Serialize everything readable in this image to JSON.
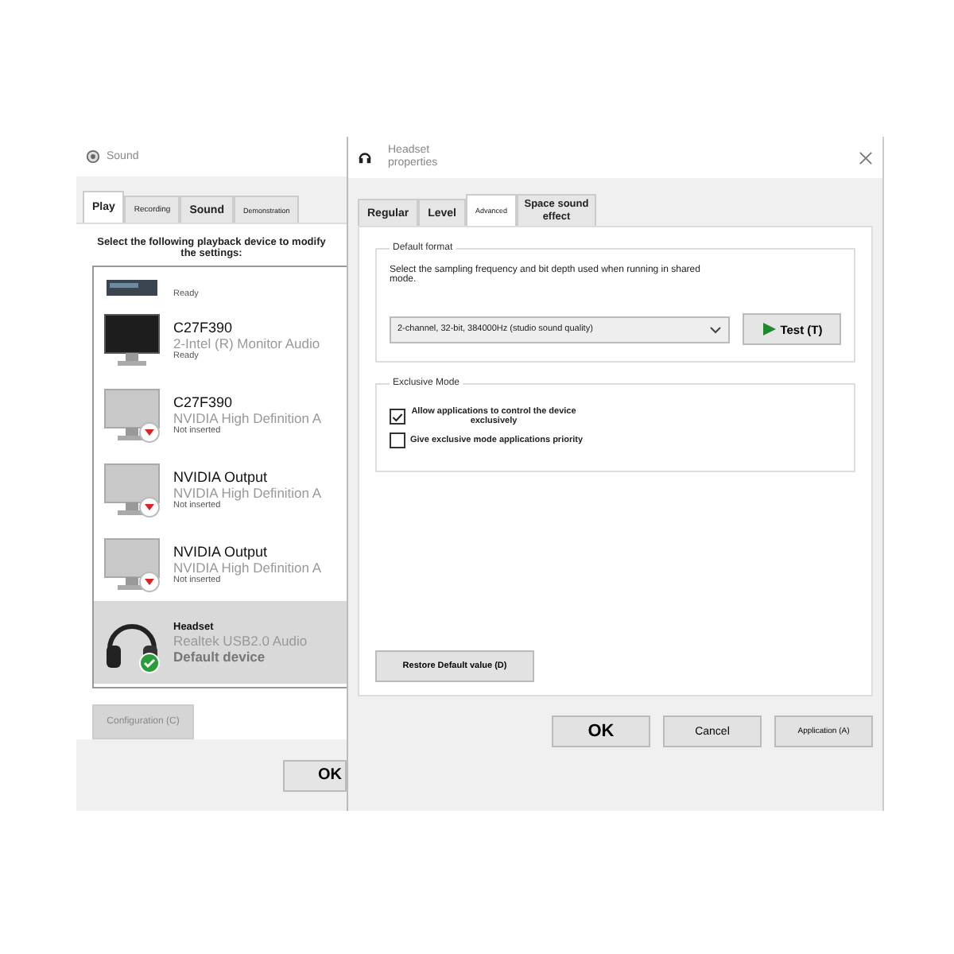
{
  "sound_window": {
    "title": "Sound",
    "tabs": [
      {
        "label": "Play",
        "selected": true
      },
      {
        "label": "Recording",
        "selected": false
      },
      {
        "label": "Sound",
        "selected": false
      },
      {
        "label": "Demonstration",
        "selected": false
      }
    ],
    "instruction": "Select the following playback device to modify the settings:",
    "devices": [
      {
        "kind": "box",
        "status_text": "Ready",
        "selected": false
      },
      {
        "kind": "monitor",
        "name": "C27F390",
        "driver": "2-Intel (R) Monitor Audio",
        "status_text": "Ready",
        "selected": false
      },
      {
        "kind": "unplugged",
        "name": "C27F390",
        "driver": "NVIDIA High Definition A",
        "status_text": "Not inserted",
        "selected": false
      },
      {
        "kind": "unplugged",
        "name": "NVIDIA Output",
        "driver": "NVIDIA High Definition A",
        "status_text": "Not inserted",
        "selected": false
      },
      {
        "kind": "unplugged",
        "name": "NVIDIA Output",
        "driver": "NVIDIA High Definition A",
        "status_text": "Not inserted",
        "selected": false
      },
      {
        "kind": "headset",
        "name": "Headset",
        "driver": "Realtek USB2.0 Audio",
        "status_text": "Default device",
        "selected": true
      }
    ],
    "configure_button": {
      "label": "Configuration (C)",
      "disabled": true
    },
    "ok_button": "OK"
  },
  "properties_window": {
    "title": "Headset properties",
    "tabs": [
      {
        "label": "Regular",
        "selected": false
      },
      {
        "label": "Level",
        "selected": false
      },
      {
        "label": "Advanced",
        "selected": true
      },
      {
        "label": "Space sound effect",
        "selected": false
      }
    ],
    "default_format": {
      "heading": "Default format",
      "description": "Select the sampling frequency and bit depth used when running in shared mode.",
      "format": "2-channel, 32-bit, 384000Hz (studio sound quality)",
      "test_button": "Test (T)"
    },
    "exclusive_mode": {
      "heading": "Exclusive Mode",
      "options": [
        {
          "label": "Allow applications to control the device exclusively",
          "checked": true
        },
        {
          "label": "Give exclusive mode applications priority",
          "checked": false
        }
      ]
    },
    "restore_button": "Restore Default value (D)",
    "buttons": [
      {
        "label": "OK",
        "kind": "primary"
      },
      {
        "label": "Cancel",
        "kind": "normal"
      },
      {
        "label": "Application (A)",
        "kind": "small"
      }
    ]
  }
}
